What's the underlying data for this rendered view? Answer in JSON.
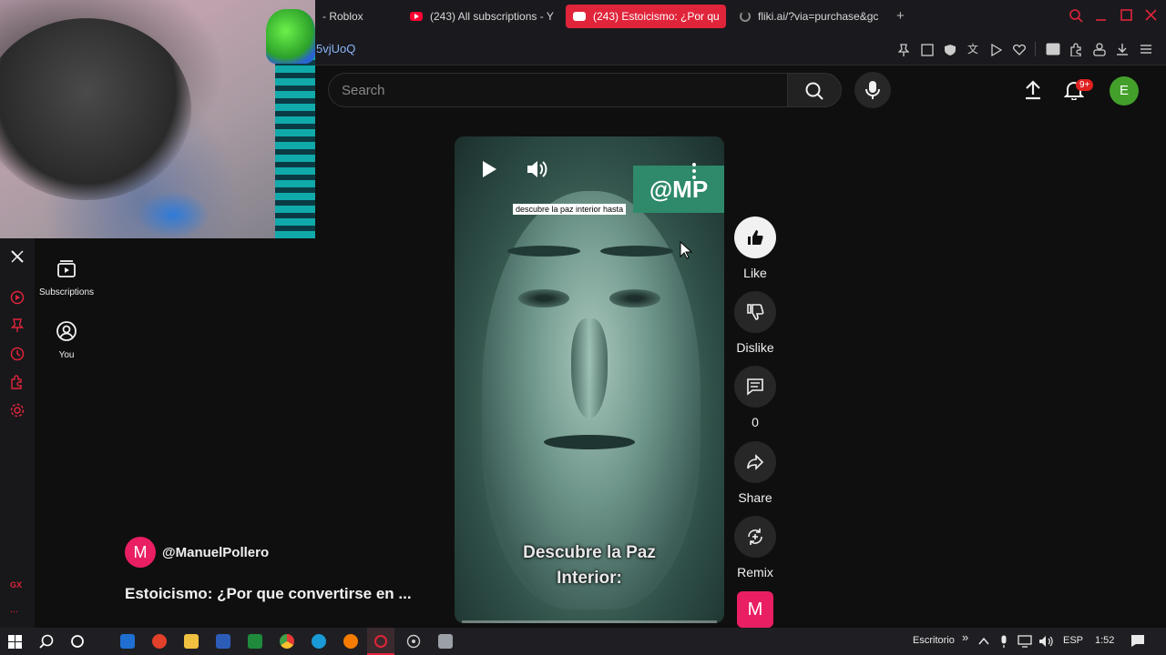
{
  "browser": {
    "tabs": [
      {
        "label": "- Roblox"
      },
      {
        "label": "(243) All subscriptions - Y"
      },
      {
        "label": "(243) Estoicismo: ¿Por qu"
      },
      {
        "label": "fliki.ai/?via=purchase&gc"
      }
    ],
    "new_tab": "+",
    "url_fragment": "5vjUoQ"
  },
  "youtube": {
    "search_placeholder": "Search",
    "notification_count": "9+",
    "user_initial": "E",
    "nav": [
      {
        "label": "Subscriptions"
      },
      {
        "label": "You"
      }
    ],
    "video": {
      "watermark": "@MP",
      "caption": "descubre la paz interior hasta",
      "subtitle_line1": "Descubre la Paz",
      "subtitle_line2": "Interior:"
    },
    "actions": {
      "like": "Like",
      "dislike": "Dislike",
      "comments": "0",
      "share": "Share",
      "remix": "Remix"
    },
    "channel": {
      "initial": "M",
      "handle": "@ManuelPollero",
      "title": "Estoicismo: ¿Por que convertirse en ..."
    }
  },
  "taskbar": {
    "desktop_label": "Escritorio",
    "chevron": "»",
    "language": "ESP",
    "time": "1:52"
  },
  "rail": {
    "gx_label": "GX",
    "more": "..."
  },
  "colors": {
    "accent": "#e0243a",
    "youtube_red": "#ff0033",
    "avatar_green": "#43a02b",
    "channel_pink": "#e91e63"
  }
}
